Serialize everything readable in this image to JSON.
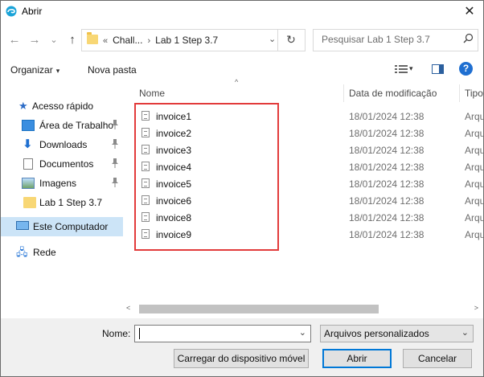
{
  "window": {
    "title": "Abrir",
    "close": "✕"
  },
  "nav": {
    "back": "←",
    "forward": "→",
    "dropdown": "⌄",
    "up": "↑"
  },
  "address": {
    "overflow": "«",
    "crumbs": [
      "Chall...",
      "Lab 1 Step 3.7"
    ],
    "separator": "›",
    "dropdown": "⌄",
    "refresh": "↻"
  },
  "search": {
    "placeholder": "Pesquisar Lab 1 Step 3.7"
  },
  "toolbar": {
    "organize_label": "Organizar",
    "new_folder_label": "Nova pasta",
    "caret": "▾",
    "help": "?"
  },
  "sidebar": {
    "items": [
      {
        "label": "Acesso rápido",
        "icon": "star-icon",
        "pinned": false
      },
      {
        "label": "Área de Trabalho",
        "icon": "desktop-icon",
        "pinned": true
      },
      {
        "label": "Downloads",
        "icon": "download-icon",
        "pinned": true
      },
      {
        "label": "Documentos",
        "icon": "documents-icon",
        "pinned": true
      },
      {
        "label": "Imagens",
        "icon": "pictures-icon",
        "pinned": true
      },
      {
        "label": "Lab 1 Step 3.7",
        "icon": "folder-icon",
        "pinned": false
      },
      {
        "label": "Este Computador",
        "icon": "computer-icon",
        "pinned": false,
        "selected": true
      },
      {
        "label": "Rede",
        "icon": "network-icon",
        "pinned": false
      }
    ],
    "pin_glyph": "📌"
  },
  "columns": {
    "name": "Nome",
    "date": "Data de modificação",
    "type": "Tipo",
    "sort_glyph": "^"
  },
  "files": [
    {
      "name": "invoice1",
      "date": "18/01/2024 12:38",
      "type": "Arqu"
    },
    {
      "name": "invoice2",
      "date": "18/01/2024 12:38",
      "type": "Arqu"
    },
    {
      "name": "invoice3",
      "date": "18/01/2024 12:38",
      "type": "Arqu"
    },
    {
      "name": "invoice4",
      "date": "18/01/2024 12:38",
      "type": "Arqu"
    },
    {
      "name": "invoice5",
      "date": "18/01/2024 12:38",
      "type": "Arqu"
    },
    {
      "name": "invoice6",
      "date": "18/01/2024 12:38",
      "type": "Arqu"
    },
    {
      "name": "invoice8",
      "date": "18/01/2024 12:38",
      "type": "Arqu"
    },
    {
      "name": "invoice9",
      "date": "18/01/2024 12:38",
      "type": "Arqu"
    }
  ],
  "scroll": {
    "left": "<",
    "right": ">"
  },
  "bottom": {
    "name_label": "Nome:",
    "name_value": "",
    "filter_value": "Arquivos personalizados",
    "dropdown": "⌄",
    "load_device_button": "Carregar do dispositivo móvel",
    "open_button": "Abrir",
    "cancel_button": "Cancelar"
  },
  "colors": {
    "highlight_border": "#e23b3b",
    "selected_bg": "#cce4f7",
    "primary_border": "#0078d7"
  }
}
